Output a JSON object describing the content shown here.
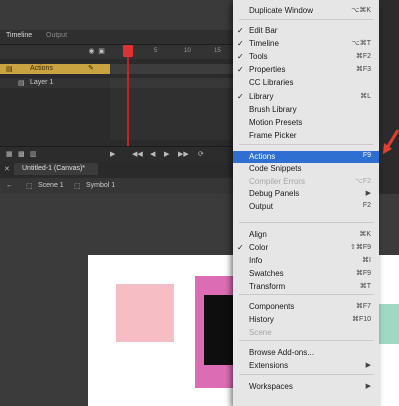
{
  "panel_tabs": [
    "Timeline",
    "Output"
  ],
  "frame_numbers": [
    "1",
    "5",
    "10",
    "15"
  ],
  "layers": [
    {
      "name": "Actions"
    },
    {
      "name": "Layer 1"
    }
  ],
  "playback_controls": [
    "▶",
    "◀◀",
    "◀",
    "▶",
    "▶▶",
    "⟳"
  ],
  "document_tab": "Untitled-1 (Canvas)*",
  "breadcrumbs": [
    "Scene 1",
    "Symbol 1"
  ],
  "colors": {
    "panel_bg": "#2b2b2b",
    "layer_highlight": "#c8a340",
    "playhead": "#c2242b",
    "menu_bg": "#e6e6e6",
    "menu_highlight": "#2f6fd2",
    "stage": "#ffffff",
    "pink": "#f6bec4",
    "magenta": "#dc6db4",
    "teal": "#9fd9c3",
    "arrow": "#e0402f"
  },
  "menu": {
    "items": [
      {
        "label": "Duplicate Window",
        "shortcut": "⌥⌘K",
        "checked": false
      },
      {
        "label": "Edit Bar",
        "shortcut": "",
        "checked": true
      },
      {
        "label": "Timeline",
        "shortcut": "⌥⌘T",
        "checked": true
      },
      {
        "label": "Tools",
        "shortcut": "⌘F2",
        "checked": true
      },
      {
        "label": "Properties",
        "shortcut": "⌘F3",
        "checked": true
      },
      {
        "label": "CC Libraries",
        "shortcut": "",
        "checked": false
      },
      {
        "label": "Library",
        "shortcut": "⌘L",
        "checked": true
      },
      {
        "label": "Brush Library",
        "shortcut": "",
        "checked": false
      },
      {
        "label": "Motion Presets",
        "shortcut": "",
        "checked": false
      },
      {
        "label": "Frame Picker",
        "shortcut": "",
        "checked": false
      },
      {
        "label": "Actions",
        "shortcut": "F9",
        "checked": false,
        "highlighted": true
      },
      {
        "label": "Code Snippets",
        "shortcut": "",
        "checked": false
      },
      {
        "label": "Compiler Errors",
        "shortcut": "⌥F2",
        "checked": false,
        "disabled": true
      },
      {
        "label": "Debug Panels",
        "shortcut": "",
        "checked": false,
        "submenu": true
      },
      {
        "label": "Output",
        "shortcut": "F2",
        "checked": false
      },
      {
        "label": "Align",
        "shortcut": "⌘K",
        "checked": false
      },
      {
        "label": "Color",
        "shortcut": "⇧⌘F9",
        "checked": true
      },
      {
        "label": "Info",
        "shortcut": "⌘I",
        "checked": false
      },
      {
        "label": "Swatches",
        "shortcut": "⌘F9",
        "checked": false
      },
      {
        "label": "Transform",
        "shortcut": "⌘T",
        "checked": false
      },
      {
        "label": "Components",
        "shortcut": "⌘F7",
        "checked": false
      },
      {
        "label": "History",
        "shortcut": "⌘F10",
        "checked": false
      },
      {
        "label": "Scene",
        "shortcut": "",
        "checked": false,
        "disabled": true
      },
      {
        "label": "Browse Add-ons...",
        "shortcut": "",
        "checked": false
      },
      {
        "label": "Extensions",
        "shortcut": "",
        "checked": false,
        "submenu": true
      },
      {
        "label": "Workspaces",
        "shortcut": "",
        "checked": false,
        "submenu": true
      }
    ]
  }
}
